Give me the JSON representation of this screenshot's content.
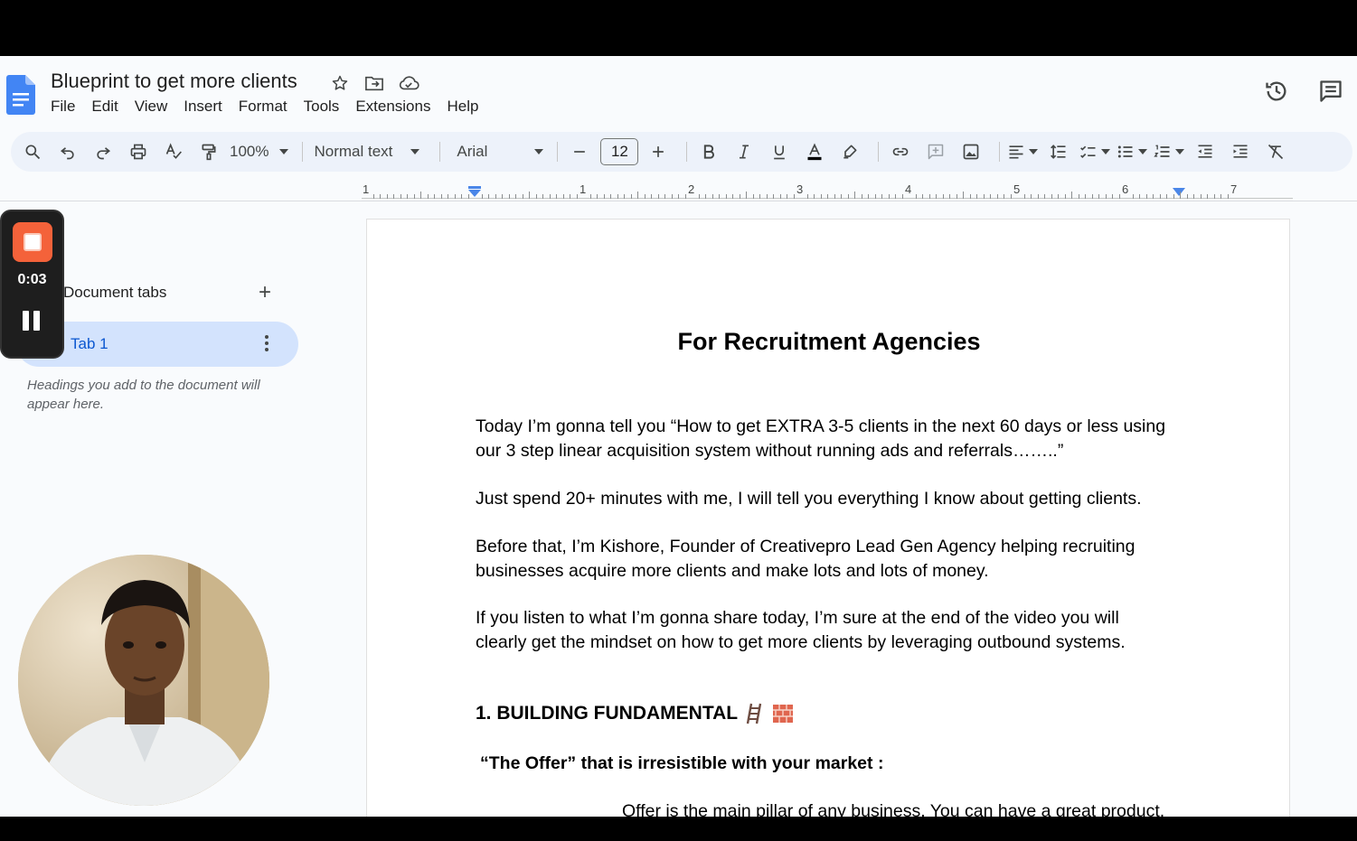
{
  "document": {
    "title": "Blueprint to get more clients"
  },
  "menu": [
    "File",
    "Edit",
    "View",
    "Insert",
    "Format",
    "Tools",
    "Extensions",
    "Help"
  ],
  "toolbar": {
    "zoom": "100%",
    "style": "Normal text",
    "font": "Arial",
    "font_size": "12"
  },
  "ruler": {
    "labels": [
      "1",
      "1",
      "2",
      "3",
      "4",
      "5",
      "6",
      "7"
    ]
  },
  "sidebar": {
    "heading": "Document tabs",
    "tab_label": "Tab 1",
    "hint": "Headings you add to the document will appear here."
  },
  "recorder": {
    "time": "0:03"
  },
  "content": {
    "heading": "For Recruitment Agencies",
    "p1": "Today I’m gonna tell you “How to get EXTRA 3-5 clients in the next 60 days or less using our 3 step linear acquisition system without running ads and referrals……..”",
    "p2": "Just spend 20+ minutes with me, I will tell you everything I know about getting clients.",
    "p3": "Before that, I’m Kishore, Founder of Creativepro Lead Gen Agency helping recruiting businesses acquire more clients and make lots and lots of money.",
    "p4": "If you listen to what I’m gonna share today, I’m sure at the end of the video you will clearly get the mindset on how to get more clients by leveraging outbound systems.",
    "section1": "1. BUILDING FUNDAMENTAL",
    "subheading": "“The Offer” that is irresistible with your market :",
    "offer_line": "Offer is the main pillar of any business. You can have a great product,"
  },
  "colors": {
    "accent": "#0b57d0",
    "tab_bg": "#d3e3fd",
    "toolbar_bg": "#edf2fa",
    "recorder_stop": "#f4623a"
  }
}
